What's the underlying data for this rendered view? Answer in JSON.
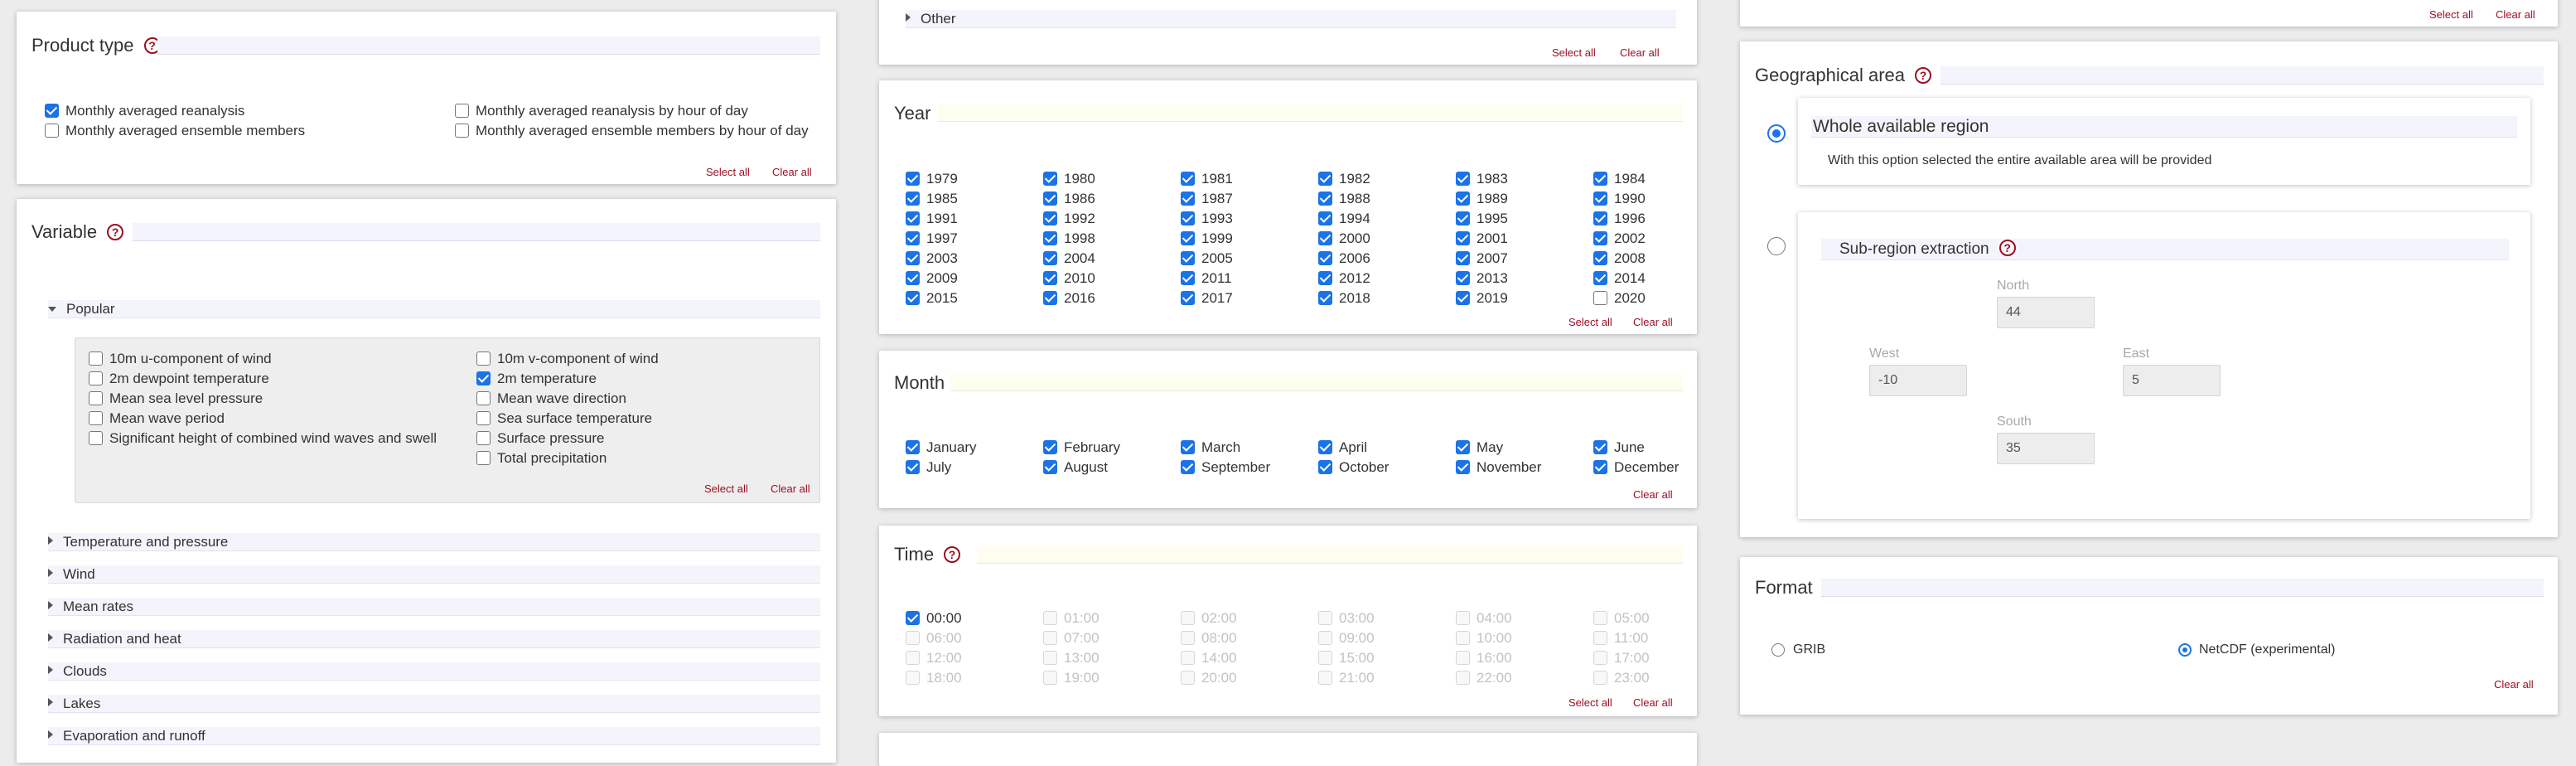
{
  "product_type": {
    "title": "Product type",
    "options": [
      {
        "label": "Monthly averaged reanalysis",
        "checked": true
      },
      {
        "label": "Monthly averaged ensemble members",
        "checked": false
      },
      {
        "label": "Monthly averaged reanalysis by hour of day",
        "checked": false
      },
      {
        "label": "Monthly averaged ensemble members by hour of day",
        "checked": false
      }
    ],
    "select_all": "Select all",
    "clear_all": "Clear all"
  },
  "variable": {
    "title": "Variable",
    "popular_label": "Popular",
    "popular_options": [
      {
        "label": "10m u-component of wind",
        "checked": false
      },
      {
        "label": "2m dewpoint temperature",
        "checked": false
      },
      {
        "label": "Mean sea level pressure",
        "checked": false
      },
      {
        "label": "Mean wave period",
        "checked": false
      },
      {
        "label": "Significant height of combined wind waves and swell",
        "checked": false
      },
      {
        "label": "10m v-component of wind",
        "checked": false
      },
      {
        "label": "2m temperature",
        "checked": true
      },
      {
        "label": "Mean wave direction",
        "checked": false
      },
      {
        "label": "Sea surface temperature",
        "checked": false
      },
      {
        "label": "Surface pressure",
        "checked": false
      },
      {
        "label": "Total precipitation",
        "checked": false
      }
    ],
    "select_all": "Select all",
    "clear_all": "Clear all",
    "groups": [
      "Temperature and pressure",
      "Wind",
      "Mean rates",
      "Radiation and heat",
      "Clouds",
      "Lakes",
      "Evaporation and runoff"
    ]
  },
  "top_middle": {
    "other_label": "Other",
    "select_all": "Select all",
    "clear_all": "Clear all"
  },
  "year": {
    "title": "Year",
    "years": [
      "1979",
      "1980",
      "1981",
      "1982",
      "1983",
      "1984",
      "1985",
      "1986",
      "1987",
      "1988",
      "1989",
      "1990",
      "1991",
      "1992",
      "1993",
      "1994",
      "1995",
      "1996",
      "1997",
      "1998",
      "1999",
      "2000",
      "2001",
      "2002",
      "2003",
      "2004",
      "2005",
      "2006",
      "2007",
      "2008",
      "2009",
      "2010",
      "2011",
      "2012",
      "2013",
      "2014",
      "2015",
      "2016",
      "2017",
      "2018",
      "2019",
      "2020"
    ],
    "unchecked": [
      "2020"
    ],
    "select_all": "Select all",
    "clear_all": "Clear all"
  },
  "month": {
    "title": "Month",
    "months": [
      "January",
      "February",
      "March",
      "April",
      "May",
      "June",
      "July",
      "August",
      "September",
      "October",
      "November",
      "December"
    ],
    "clear_all": "Clear all"
  },
  "time": {
    "title": "Time",
    "times": [
      "00:00",
      "01:00",
      "02:00",
      "03:00",
      "04:00",
      "05:00",
      "06:00",
      "07:00",
      "08:00",
      "09:00",
      "10:00",
      "11:00",
      "12:00",
      "13:00",
      "14:00",
      "15:00",
      "16:00",
      "17:00",
      "18:00",
      "19:00",
      "20:00",
      "21:00",
      "22:00",
      "23:00"
    ],
    "checked": "00:00",
    "select_all": "Select all",
    "clear_all": "Clear all"
  },
  "top_right": {
    "select_all": "Select all",
    "clear_all": "Clear all"
  },
  "geo": {
    "title": "Geographical area",
    "whole_title": "Whole available region",
    "whole_desc": "With this option selected the entire available area will be provided",
    "sub_title": "Sub-region extraction",
    "north_label": "North",
    "north": "44",
    "west_label": "West",
    "west": "-10",
    "east_label": "East",
    "east": "5",
    "south_label": "South",
    "south": "35"
  },
  "format": {
    "title": "Format",
    "grib": "GRIB",
    "netcdf": "NetCDF (experimental)",
    "clear_all": "Clear all"
  },
  "colors": {
    "accent": "#1a73e8",
    "link": "#9b0f22"
  }
}
